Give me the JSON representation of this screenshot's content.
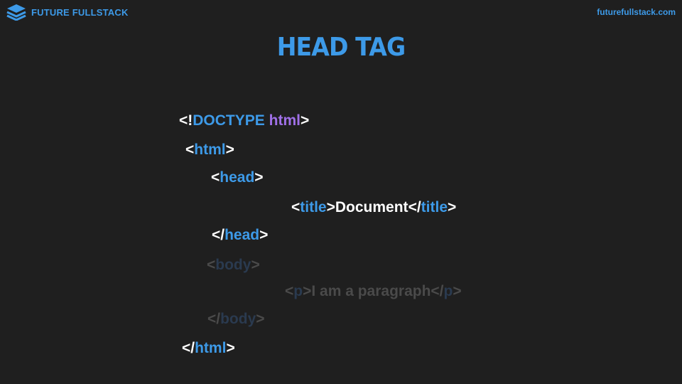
{
  "brand": {
    "name": "FUTURE FULLSTACK",
    "icon": "stacked-layers-icon",
    "url": "futurefullstack.com"
  },
  "slide": {
    "title": "HEAD TAG"
  },
  "code": {
    "doctype": {
      "open": "<!",
      "keyword": "DOCTYPE",
      "attr": "html",
      "close": ">"
    },
    "html_open": {
      "open": "<",
      "tag": "html",
      "close": ">"
    },
    "head_open": {
      "open": "<",
      "tag": "head",
      "close": ">"
    },
    "title_line": {
      "open": "<",
      "tag": "title",
      "mid": ">",
      "text": "Document",
      "close_open": "</",
      "close_tag": "title",
      "close": ">"
    },
    "head_close": {
      "open": "</",
      "tag": "head",
      "close": ">"
    },
    "body_open": {
      "open": "<",
      "tag": "body",
      "close": ">"
    },
    "p_line": {
      "open": "<",
      "tag": "p",
      "mid": ">",
      "text": "I am a paragraph",
      "close_open": "</",
      "close_tag": "p",
      "close": ">"
    },
    "body_close": {
      "open": "</",
      "tag": "body",
      "close": ">"
    },
    "html_close": {
      "open": "</",
      "tag": "html",
      "close": ">"
    }
  },
  "colors": {
    "background": "#1f1f1f",
    "accent": "#3d9ae8",
    "attribute": "#a070e8",
    "text": "#ffffff",
    "faded": "#4a4a4a"
  }
}
